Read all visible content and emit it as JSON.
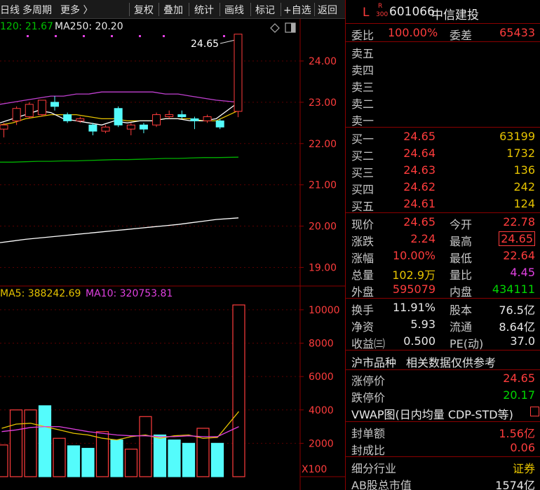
{
  "toolbar": {
    "items": [
      "日线",
      "多周期",
      "更多 〉",
      "复权",
      "叠加",
      "统计",
      "画线",
      "标记",
      "+自选",
      "返回"
    ]
  },
  "ma_legend": {
    "ma120": "120: 21.67",
    "ma250": "MA250: 20.20"
  },
  "vol_legend": {
    "ma5": "MA5: 388242.69",
    "ma10": "MA10: 320753.81"
  },
  "price_axis": [
    "24.00",
    "23.00",
    "22.00",
    "21.00",
    "20.00",
    "19.00"
  ],
  "volume_axis": [
    "10000",
    "8000",
    "6000",
    "4000",
    "2000"
  ],
  "volume_unit": "X100",
  "last_price_label": "24.65",
  "stock": {
    "prefix": "L",
    "tag_top": "R",
    "tag_bottom": "300",
    "code": "601066",
    "name": "中信建投"
  },
  "weibi": {
    "label": "委比",
    "value": "100.00%",
    "label2": "委差",
    "value2": "65433"
  },
  "asks": [
    {
      "label": "卖五",
      "price": "",
      "vol": ""
    },
    {
      "label": "卖四",
      "price": "",
      "vol": ""
    },
    {
      "label": "卖三",
      "price": "",
      "vol": ""
    },
    {
      "label": "卖二",
      "price": "",
      "vol": ""
    },
    {
      "label": "卖一",
      "price": "",
      "vol": ""
    }
  ],
  "bids": [
    {
      "label": "买一",
      "price": "24.65",
      "vol": "63199"
    },
    {
      "label": "买二",
      "price": "24.64",
      "vol": "1732"
    },
    {
      "label": "买三",
      "price": "24.63",
      "vol": "136"
    },
    {
      "label": "买四",
      "price": "24.62",
      "vol": "242"
    },
    {
      "label": "买五",
      "price": "24.61",
      "vol": "124"
    }
  ],
  "quote": [
    {
      "l1": "现价",
      "v1": "24.65",
      "c1": "red",
      "l2": "今开",
      "v2": "22.78",
      "c2": "red"
    },
    {
      "l1": "涨跌",
      "v1": "2.24",
      "c1": "red",
      "l2": "最高",
      "v2": "24.65",
      "c2": "red"
    },
    {
      "l1": "涨幅",
      "v1": "10.00%",
      "c1": "red",
      "l2": "最低",
      "v2": "22.64",
      "c2": "red"
    },
    {
      "l1": "总量",
      "v1": "102.9万",
      "c1": "yellow",
      "l2": "量比",
      "v2": "4.45",
      "c2": "magenta"
    },
    {
      "l1": "外盘",
      "v1": "595079",
      "c1": "red",
      "l2": "内盘",
      "v2": "434111",
      "c2": "green"
    }
  ],
  "fundamentals": [
    {
      "l1": "换手",
      "v1": "11.91%",
      "l2": "股本",
      "v2": "76.5亿"
    },
    {
      "l1": "净资",
      "v1": "5.93",
      "l2": "流通",
      "v2": "8.64亿"
    },
    {
      "l1": "收益㈢",
      "v1": "0.500",
      "l2": "PE(动)",
      "v2": "37.0"
    }
  ],
  "section_header": {
    "left": "沪市品种",
    "right": "相关数据仅供参考"
  },
  "limits": [
    {
      "label": "涨停价",
      "value": "24.65",
      "color": "red"
    },
    {
      "label": "跌停价",
      "value": "20.17",
      "color": "green"
    }
  ],
  "vwap": "VWAP图(日内均量 CDP-STD等)",
  "seal": [
    {
      "label": "封单额",
      "value": "1.56亿"
    },
    {
      "label": "封成比",
      "value": "0.06"
    }
  ],
  "industry": {
    "label": "细分行业",
    "value": "证券"
  },
  "market_cap": {
    "label": "AB股总市值",
    "value": "1574亿"
  },
  "colors": {
    "up": "#ff3c3c",
    "down": "#54fcfc",
    "ma_white": "#ffffff",
    "ma_yellow": "#e6c300",
    "ma_magenta": "#c040d0",
    "ma_green": "#00b000",
    "grid": "#5a0000"
  },
  "chart_data": {
    "type": "candlestick",
    "price_ylim": [
      18.6,
      24.9
    ],
    "volume_ylim": [
      0,
      10500
    ],
    "candles": [
      {
        "o": 22.35,
        "c": 22.45,
        "h": 22.5,
        "l": 22.15
      },
      {
        "o": 22.55,
        "c": 22.85,
        "h": 22.9,
        "l": 22.45
      },
      {
        "o": 22.65,
        "c": 22.95,
        "h": 23.0,
        "l": 22.6
      },
      {
        "o": 22.7,
        "c": 23.05,
        "h": 23.05,
        "l": 22.65
      },
      {
        "o": 23.0,
        "c": 22.9,
        "h": 23.15,
        "l": 22.8
      },
      {
        "o": 22.7,
        "c": 22.55,
        "h": 22.75,
        "l": 22.5
      },
      {
        "o": 22.55,
        "c": 22.6,
        "h": 22.65,
        "l": 22.5
      },
      {
        "o": 22.45,
        "c": 22.3,
        "h": 22.5,
        "l": 22.2
      },
      {
        "o": 22.3,
        "c": 22.4,
        "h": 22.45,
        "l": 22.25
      },
      {
        "o": 22.85,
        "c": 22.45,
        "h": 22.9,
        "l": 22.4
      },
      {
        "o": 22.35,
        "c": 22.45,
        "h": 22.5,
        "l": 22.2
      },
      {
        "o": 22.45,
        "c": 22.35,
        "h": 22.5,
        "l": 22.25
      },
      {
        "o": 22.45,
        "c": 22.7,
        "h": 22.75,
        "l": 22.4
      },
      {
        "o": 22.65,
        "c": 22.7,
        "h": 22.8,
        "l": 22.6
      },
      {
        "o": 22.7,
        "c": 22.65,
        "h": 22.8,
        "l": 22.6
      },
      {
        "o": 22.6,
        "c": 22.55,
        "h": 22.65,
        "l": 22.35
      },
      {
        "o": 22.55,
        "c": 22.65,
        "h": 22.7,
        "l": 22.5
      },
      {
        "o": 22.55,
        "c": 22.4,
        "h": 22.6,
        "l": 22.35
      },
      {
        "o": 22.78,
        "c": 24.65,
        "h": 24.65,
        "l": 22.64
      }
    ],
    "volumes": [
      1900,
      4000,
      4000,
      4250,
      2300,
      1850,
      1700,
      2700,
      2200,
      1650,
      3600,
      2500,
      2200,
      2000,
      2900,
      2000,
      10290
    ],
    "ma_lines": {
      "ma5": [
        22.5,
        22.6,
        22.7,
        22.8,
        22.75,
        22.6,
        22.55,
        22.5,
        22.45,
        22.55,
        22.5,
        22.55,
        22.55,
        22.6,
        22.6,
        22.55,
        22.55,
        22.6,
        23.0
      ],
      "ma10": [
        22.45,
        22.5,
        22.6,
        22.65,
        22.7,
        22.7,
        22.7,
        22.65,
        22.6,
        22.6,
        22.55,
        22.55,
        22.55,
        22.6,
        22.6,
        22.6,
        22.55,
        22.55,
        22.8
      ],
      "ma60": [
        22.95,
        23.0,
        23.05,
        23.1,
        23.15,
        23.15,
        23.2,
        23.2,
        23.25,
        23.25,
        23.25,
        23.25,
        23.25,
        23.2,
        23.2,
        23.15,
        23.1,
        23.05,
        23.0
      ],
      "ma120": [
        21.55,
        21.55,
        21.56,
        21.57,
        21.57,
        21.58,
        21.58,
        21.59,
        21.6,
        21.61,
        21.61,
        21.62,
        21.63,
        21.64,
        21.64,
        21.65,
        21.66,
        21.66,
        21.67
      ],
      "ma250": [
        19.6,
        19.64,
        19.68,
        19.71,
        19.74,
        19.77,
        19.8,
        19.83,
        19.86,
        19.89,
        19.92,
        19.95,
        19.98,
        20.01,
        20.04,
        20.08,
        20.12,
        20.16,
        20.2
      ]
    },
    "vol_ma5": [
      2900,
      3150,
      3200,
      3000,
      2800,
      2600,
      2500,
      2300,
      2200,
      2400,
      2500,
      2300,
      2450,
      2500,
      2300,
      2350,
      3900
    ],
    "vol_ma10": [
      2700,
      2800,
      2950,
      3000,
      3000,
      2850,
      2700,
      2600,
      2500,
      2450,
      2450,
      2400,
      2400,
      2450,
      2400,
      2400,
      3000
    ]
  }
}
